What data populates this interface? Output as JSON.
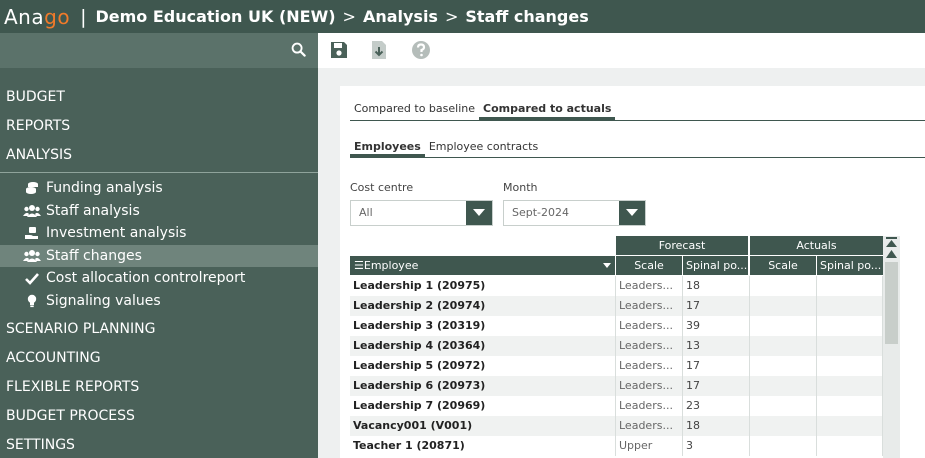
{
  "header": {
    "logo_prefix": "Ana",
    "logo_suffix": "go",
    "separator": "|",
    "breadcrumb": [
      "Demo Education UK (NEW)",
      "Analysis",
      "Staff changes"
    ],
    "breadcrumb_sep": ">"
  },
  "sidebar": {
    "top_items": [
      "BUDGET",
      "REPORTS",
      "ANALYSIS"
    ],
    "sub_items": [
      {
        "label": "Funding analysis",
        "icon": "coins-icon"
      },
      {
        "label": "Staff analysis",
        "icon": "users-icon"
      },
      {
        "label": "Investment analysis",
        "icon": "hand-coin-icon"
      },
      {
        "label": "Staff changes",
        "icon": "users-icon",
        "active": true
      },
      {
        "label": "Cost allocation controlreport",
        "icon": "check-icon"
      },
      {
        "label": "Signaling values",
        "icon": "lightbulb-icon"
      }
    ],
    "bottom_items": [
      "SCENARIO PLANNING",
      "ACCOUNTING",
      "FLEXIBLE REPORTS",
      "BUDGET PROCESS",
      "SETTINGS"
    ]
  },
  "toolbar": {
    "buttons": [
      "save-icon",
      "export-icon",
      "help-icon"
    ]
  },
  "tabs": {
    "compare": [
      "Compared to baseline",
      "Compared to actuals"
    ],
    "compare_active": 1,
    "entity": [
      "Employees",
      "Employee contracts"
    ],
    "entity_active": 0
  },
  "filters": {
    "cost_centre_label": "Cost centre",
    "cost_centre_value": "All",
    "month_label": "Month",
    "month_value": "Sept-2024"
  },
  "grid": {
    "group_headers": [
      "Forecast",
      "Actuals"
    ],
    "columns": [
      "Employee",
      "Scale",
      "Spinal po...",
      "Scale",
      "Spinal po..."
    ],
    "rows": [
      [
        "Leadership 1 (20975)",
        "Leaders...",
        "18",
        "",
        ""
      ],
      [
        "Leadership 2 (20974)",
        "Leaders...",
        "17",
        "",
        ""
      ],
      [
        "Leadership 3 (20319)",
        "Leaders...",
        "39",
        "",
        ""
      ],
      [
        "Leadership 4 (20364)",
        "Leaders...",
        "13",
        "",
        ""
      ],
      [
        "Leadership 5 (20972)",
        "Leaders...",
        "17",
        "",
        ""
      ],
      [
        "Leadership 6 (20973)",
        "Leaders...",
        "17",
        "",
        ""
      ],
      [
        "Leadership 7 (20969)",
        "Leaders...",
        "23",
        "",
        ""
      ],
      [
        "Vacancy001 (V001)",
        "Leaders...",
        "18",
        "",
        ""
      ],
      [
        "Teacher 1 (20871)",
        "Upper",
        "3",
        "",
        ""
      ]
    ]
  },
  "colors": {
    "header_bg": "#3f574f",
    "sidebar_bg": "#4a6159",
    "active_item_bg": "#6f847c",
    "logo_accent": "#f07a2a"
  }
}
